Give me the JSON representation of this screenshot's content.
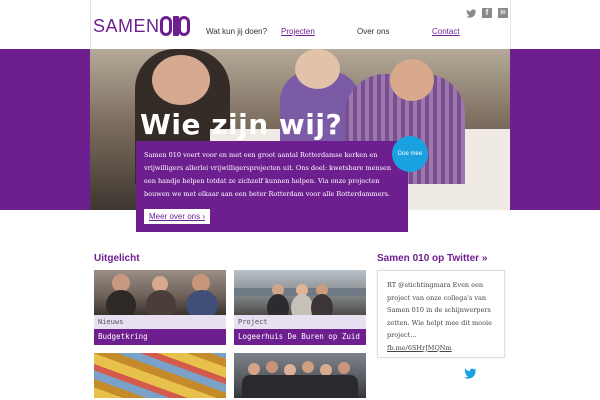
{
  "header": {
    "logo_text": "SAMEN",
    "nav": [
      {
        "label": "Wat kun jij doen?"
      },
      {
        "label": "Projecten"
      },
      {
        "label": "Over ons"
      },
      {
        "label": "Contact"
      }
    ],
    "social": [
      {
        "icon": "twitter-icon"
      },
      {
        "icon": "facebook-icon",
        "glyph": "f"
      },
      {
        "icon": "linkedin-icon",
        "glyph": "in"
      }
    ]
  },
  "hero": {
    "title": "Wie zijn wij?",
    "intro": "Samen 010 voert voor en met een groot aantal Rotterdamse kerken en vrijwilligers allerlei vrijwilligersprojecten uit. Ons doel: kwetsbare mensen een handje helpen totdat ze zichzelf kunnen helpen. Via onze projecten bouwen we met elkaar aan een beter Rotterdam voor alle Rotterdammers.",
    "more_button": "Meer over ons ›",
    "cta_badge": "Doe mee"
  },
  "featured": {
    "title": "Uitgelicht",
    "cards": [
      {
        "tag": "Nieuws",
        "label": "Budgetkring"
      },
      {
        "tag": "Project",
        "label": "Logeerhuis De Buren op Zuid"
      },
      {
        "tag": "",
        "label": ""
      },
      {
        "tag": "",
        "label": ""
      }
    ]
  },
  "twitter": {
    "title": "Samen 010 op Twitter »",
    "tweet": "RT @stichtingmara Even een project van onze collega's van Samen 010 in de schijnwerpers zetten. Wie helpt mee dit mooie project...",
    "link": "fb.me/6SHrJMQNm"
  },
  "colors": {
    "brand_purple": "#6e1f8f",
    "accent_blue": "#1aa1e0"
  }
}
